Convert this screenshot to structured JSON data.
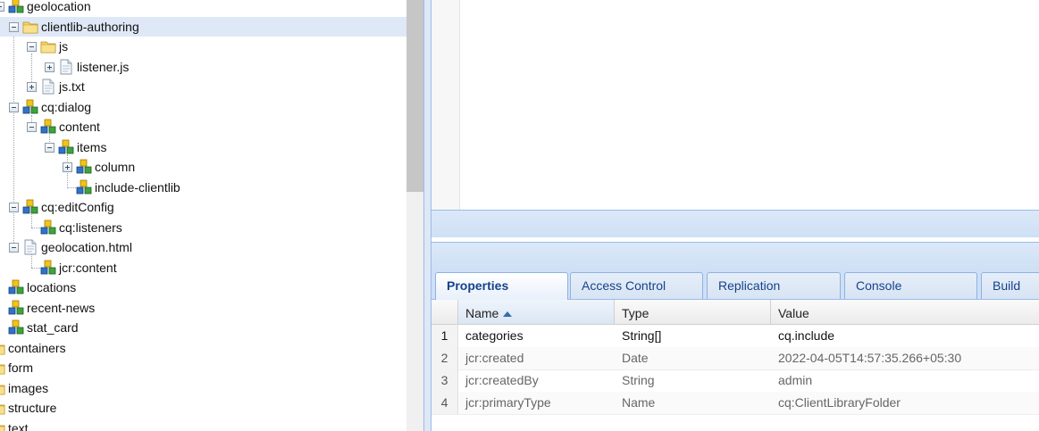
{
  "tree": {
    "items": [
      {
        "label": "geolocation",
        "icon": "component-icon",
        "expanded": true
      },
      {
        "label": "clientlib-authoring",
        "icon": "folder-icon",
        "expanded": true,
        "selected": true
      },
      {
        "label": "js",
        "icon": "folder-icon",
        "expanded": true
      },
      {
        "label": "listener.js",
        "icon": "file-icon",
        "expanded": false
      },
      {
        "label": "js.txt",
        "icon": "file-icon",
        "expanded": false
      },
      {
        "label": "cq:dialog",
        "icon": "component-icon",
        "expanded": true
      },
      {
        "label": "content",
        "icon": "component-icon",
        "expanded": true
      },
      {
        "label": "items",
        "icon": "component-icon",
        "expanded": true
      },
      {
        "label": "column",
        "icon": "component-icon",
        "expanded": false
      },
      {
        "label": "include-clientlib",
        "icon": "component-icon"
      },
      {
        "label": "cq:editConfig",
        "icon": "component-icon",
        "expanded": true
      },
      {
        "label": "cq:listeners",
        "icon": "component-icon"
      },
      {
        "label": "geolocation.html",
        "icon": "file-icon",
        "expanded": true
      },
      {
        "label": "jcr:content",
        "icon": "component-icon"
      },
      {
        "label": "locations",
        "icon": "component-icon"
      },
      {
        "label": "recent-news",
        "icon": "component-icon"
      },
      {
        "label": "stat_card",
        "icon": "component-icon"
      },
      {
        "label": "containers",
        "icon": "folder-icon"
      },
      {
        "label": "form",
        "icon": "folder-icon"
      },
      {
        "label": "images",
        "icon": "folder-icon"
      },
      {
        "label": "structure",
        "icon": "folder-icon"
      },
      {
        "label": "text",
        "icon": "folder-icon"
      }
    ]
  },
  "tabs": [
    {
      "label": "Properties",
      "active": true
    },
    {
      "label": "Access Control"
    },
    {
      "label": "Replication"
    },
    {
      "label": "Console"
    },
    {
      "label": "Build Info"
    }
  ],
  "grid": {
    "columns": [
      "Name",
      "Type",
      "Value"
    ],
    "sorted_column": "Name",
    "rows": [
      {
        "num": "1",
        "name": "categories",
        "type": "String[]",
        "value": "cq.include"
      },
      {
        "num": "2",
        "name": "jcr:created",
        "type": "Date",
        "value": "2022-04-05T14:57:35.266+05:30"
      },
      {
        "num": "3",
        "name": "jcr:createdBy",
        "type": "String",
        "value": "admin"
      },
      {
        "num": "4",
        "name": "jcr:primaryType",
        "type": "Name",
        "value": "cq:ClientLibraryFolder"
      }
    ]
  },
  "colors": {
    "accent": "#15428b",
    "selection": "#dfe8f6",
    "panel_border": "#99bbe8"
  }
}
